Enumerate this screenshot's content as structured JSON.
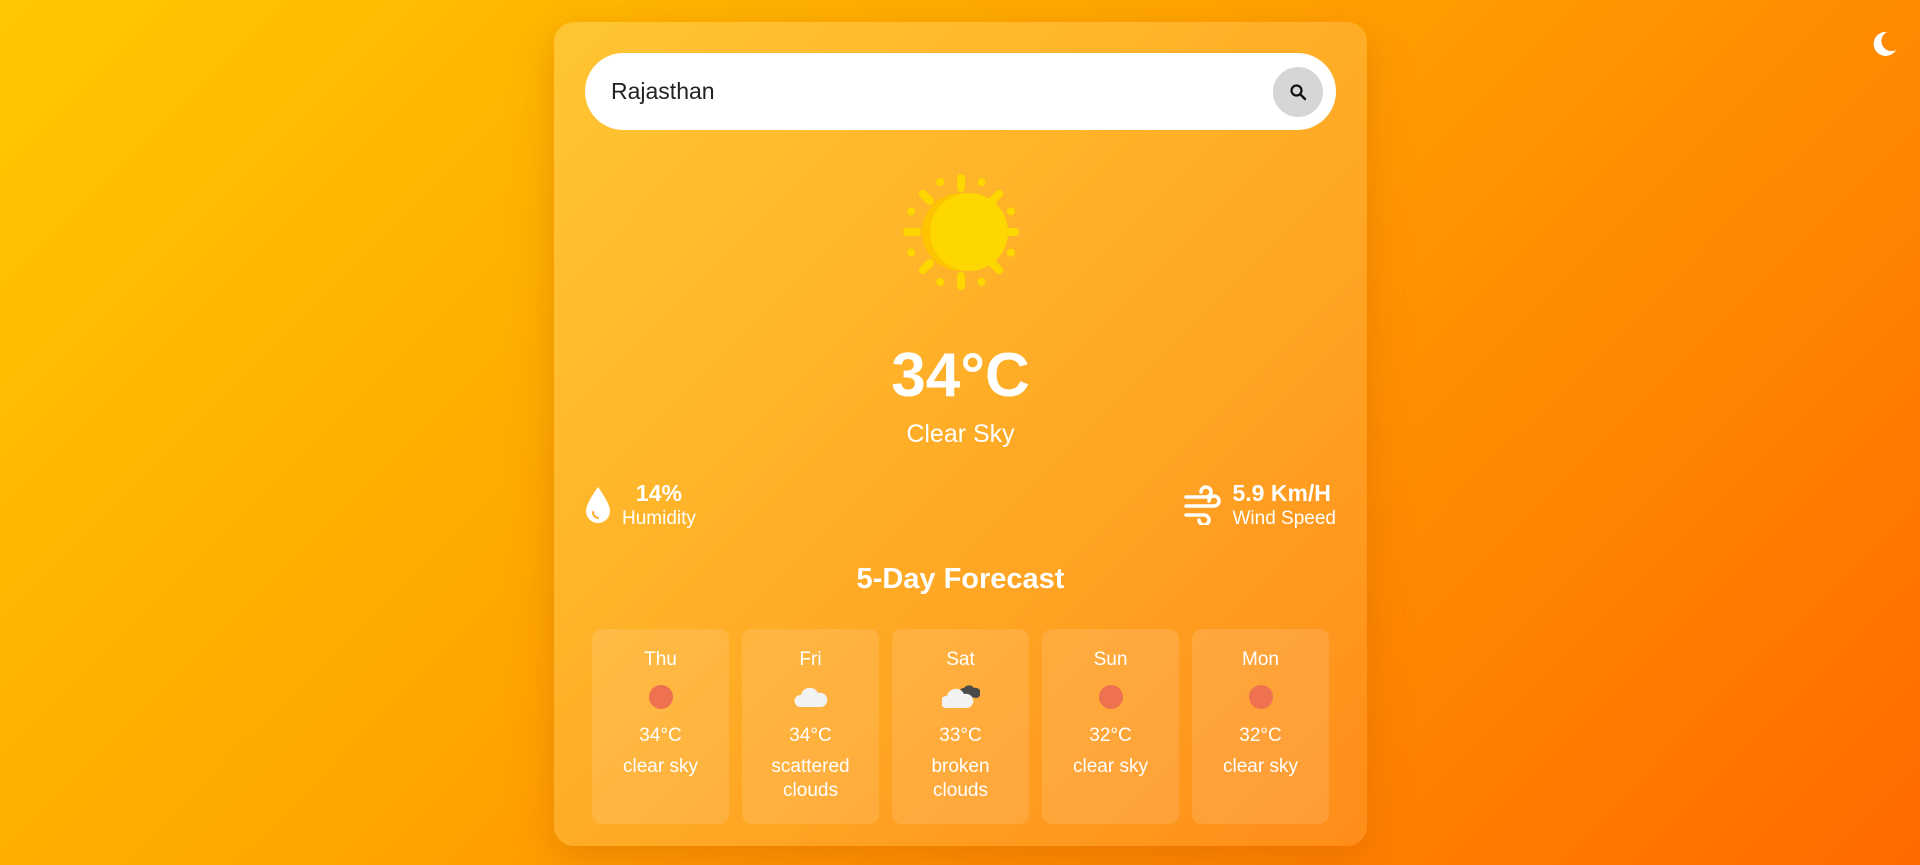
{
  "theme_toggle": {
    "icon": "moon-icon"
  },
  "search": {
    "value": "Rajasthan",
    "icon": "search-icon"
  },
  "current": {
    "icon": "sun-icon",
    "temperature": "34°C",
    "condition": "Clear Sky"
  },
  "humidity": {
    "value": "14%",
    "label": "Humidity",
    "icon": "water-drop-icon"
  },
  "wind": {
    "value": "5.9 Km/H",
    "label": "Wind Speed",
    "icon": "wind-icon"
  },
  "forecast": {
    "title": "5-Day Forecast",
    "days": [
      {
        "day": "Thu",
        "temp": "34°C",
        "desc": "clear sky",
        "icon": "clear-sky-icon"
      },
      {
        "day": "Fri",
        "temp": "34°C",
        "desc": "scattered clouds",
        "icon": "scattered-clouds-icon"
      },
      {
        "day": "Sat",
        "temp": "33°C",
        "desc": "broken clouds",
        "icon": "broken-clouds-icon"
      },
      {
        "day": "Sun",
        "temp": "32°C",
        "desc": "clear sky",
        "icon": "clear-sky-icon"
      },
      {
        "day": "Mon",
        "temp": "32°C",
        "desc": "clear sky",
        "icon": "clear-sky-icon"
      }
    ]
  },
  "colors": {
    "background_start": "#ffc800",
    "background_end": "#ff6a00",
    "sun": "#ffd700",
    "clear_sky_dot": "#ee7150"
  }
}
